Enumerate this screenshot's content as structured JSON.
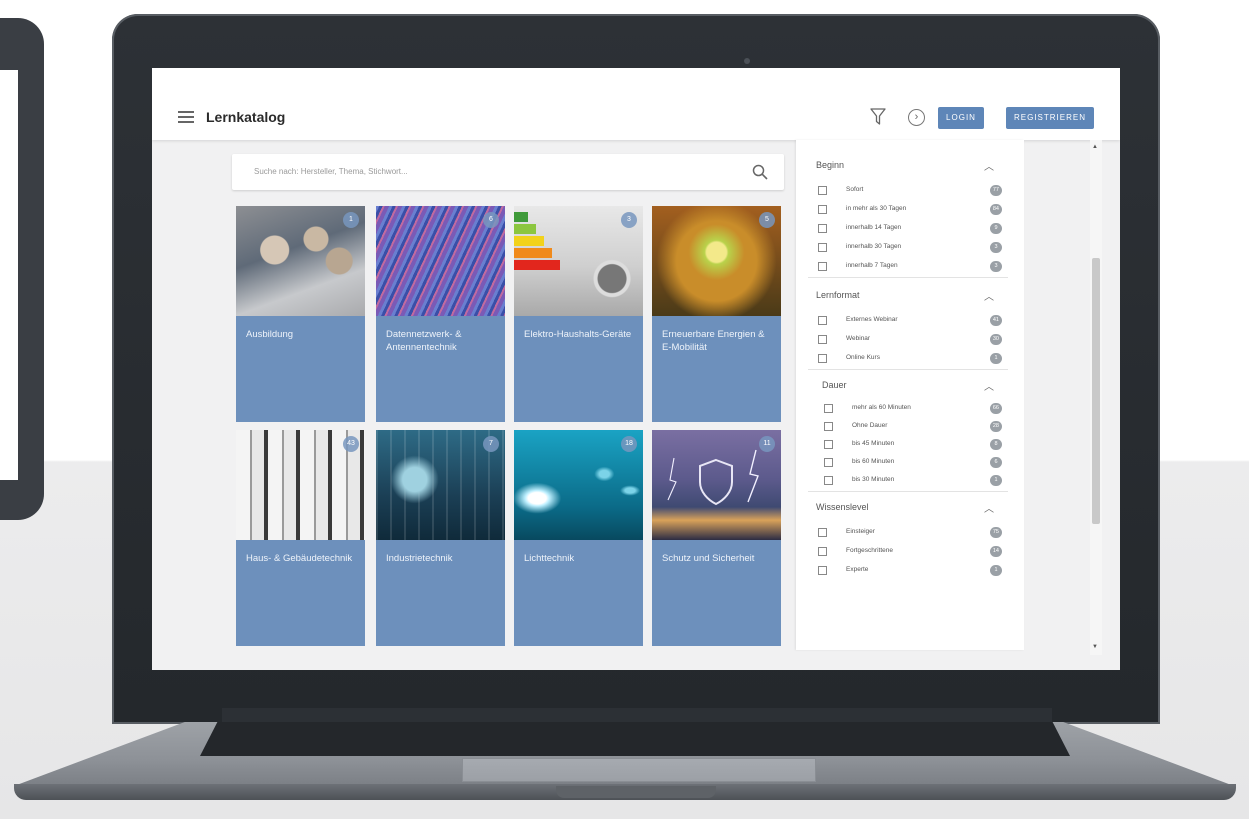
{
  "app": {
    "title": "Lernkatalog",
    "login_label": "LOGIN",
    "register_label": "REGISTRIEREN",
    "accent_color": "#5e86b8"
  },
  "search": {
    "placeholder": "Suche nach: Hersteller, Thema, Stichwort..."
  },
  "categories": [
    {
      "label": "Ausbildung",
      "count": "1"
    },
    {
      "label": "Datennetzwerk- & Antennentechnik",
      "count": "6"
    },
    {
      "label": "Elektro-Haushalts-Geräte",
      "count": "3"
    },
    {
      "label": "Erneuerbare Energien & E-Mobilität",
      "count": "5"
    },
    {
      "label": "Haus- & Gebäudetechnik",
      "count": "43"
    },
    {
      "label": "Industrietechnik",
      "count": "7"
    },
    {
      "label": "Lichttechnik",
      "count": "18"
    },
    {
      "label": "Schutz und Sicherheit",
      "count": "11"
    }
  ],
  "filters": {
    "beginn": {
      "title": "Beginn",
      "options": [
        {
          "label": "Sofort",
          "count": "77"
        },
        {
          "label": "in mehr als 30 Tagen",
          "count": "84"
        },
        {
          "label": "innerhalb 14 Tagen",
          "count": "9"
        },
        {
          "label": "innerhalb 30 Tagen",
          "count": "3"
        },
        {
          "label": "innerhalb 7 Tagen",
          "count": "3"
        }
      ]
    },
    "lernformat": {
      "title": "Lernformat",
      "options": [
        {
          "label": "Externes Webinar",
          "count": "41"
        },
        {
          "label": "Webinar",
          "count": "30"
        },
        {
          "label": "Online Kurs",
          "count": "1"
        }
      ]
    },
    "dauer": {
      "title": "Dauer",
      "options": [
        {
          "label": "mehr als 60 Minuten",
          "count": "66"
        },
        {
          "label": "Ohne Dauer",
          "count": "28"
        },
        {
          "label": "bis 45 Minuten",
          "count": "8"
        },
        {
          "label": "bis 60 Minuten",
          "count": "6"
        },
        {
          "label": "bis 30 Minuten",
          "count": "1"
        }
      ]
    },
    "wissenslevel": {
      "title": "Wissenslevel",
      "options": [
        {
          "label": "Einsteiger",
          "count": "75"
        },
        {
          "label": "Fortgeschrittene",
          "count": "14"
        },
        {
          "label": "Experte",
          "count": "1"
        }
      ]
    }
  }
}
